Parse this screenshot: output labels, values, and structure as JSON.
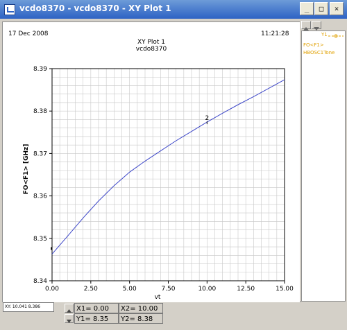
{
  "window": {
    "title": "vcdo8370 - vcdo8370 - XY Plot 1",
    "buttons": {
      "minimize": "_",
      "restore": "□",
      "close": "×"
    }
  },
  "plot": {
    "date": "17 Dec 2008",
    "time": "11:21:28",
    "title_line1": "XY Plot 1",
    "title_line2": "vcdo8370",
    "marker_label": "2"
  },
  "legend": {
    "y_indicator": "Y1",
    "entry_line1": "FO<F1>",
    "entry_line2": "HBOSC1Tone"
  },
  "status": {
    "xy_readout": "XY: 10.041 8.386",
    "x1": "X1= 0.00",
    "x2": "X2= 10.00",
    "y1": "Y1= 8.35",
    "y2": "Y2= 8.38"
  },
  "chart_data": {
    "type": "line",
    "title": "XY Plot 1",
    "subtitle": "vcdo8370",
    "xlabel": "vt",
    "ylabel": "FO<F1> [GHz]",
    "xlim": [
      0,
      15
    ],
    "ylim": [
      8.34,
      8.39
    ],
    "x_ticks": [
      "0.00",
      "2.50",
      "5.00",
      "7.50",
      "10.00",
      "12.50",
      "15.00"
    ],
    "y_ticks": [
      "8.34",
      "8.35",
      "8.36",
      "8.37",
      "8.38",
      "8.39"
    ],
    "grid": true,
    "series": [
      {
        "name": "FO<F1> HBOSC1Tone",
        "color": "#3c46c8",
        "x": [
          0,
          1.0,
          2.0,
          3.0,
          4.0,
          5.0,
          6.0,
          7.0,
          8.0,
          9.0,
          10.0,
          11.0,
          12.0,
          13.0,
          14.0,
          15.0
        ],
        "y": [
          8.3463,
          8.3505,
          8.3548,
          8.3588,
          8.3624,
          8.3656,
          8.3682,
          8.3706,
          8.373,
          8.3752,
          8.3774,
          8.3795,
          8.3815,
          8.3834,
          8.3854,
          8.3874
        ]
      }
    ],
    "markers": [
      {
        "label": "2",
        "x": 10.0,
        "y": 8.3774
      }
    ]
  },
  "colors": {
    "titlebar_start": "#6d9bd8",
    "titlebar_end": "#2d62c4",
    "legend_text": "#e0a000",
    "grid": "#c8c8c8"
  }
}
